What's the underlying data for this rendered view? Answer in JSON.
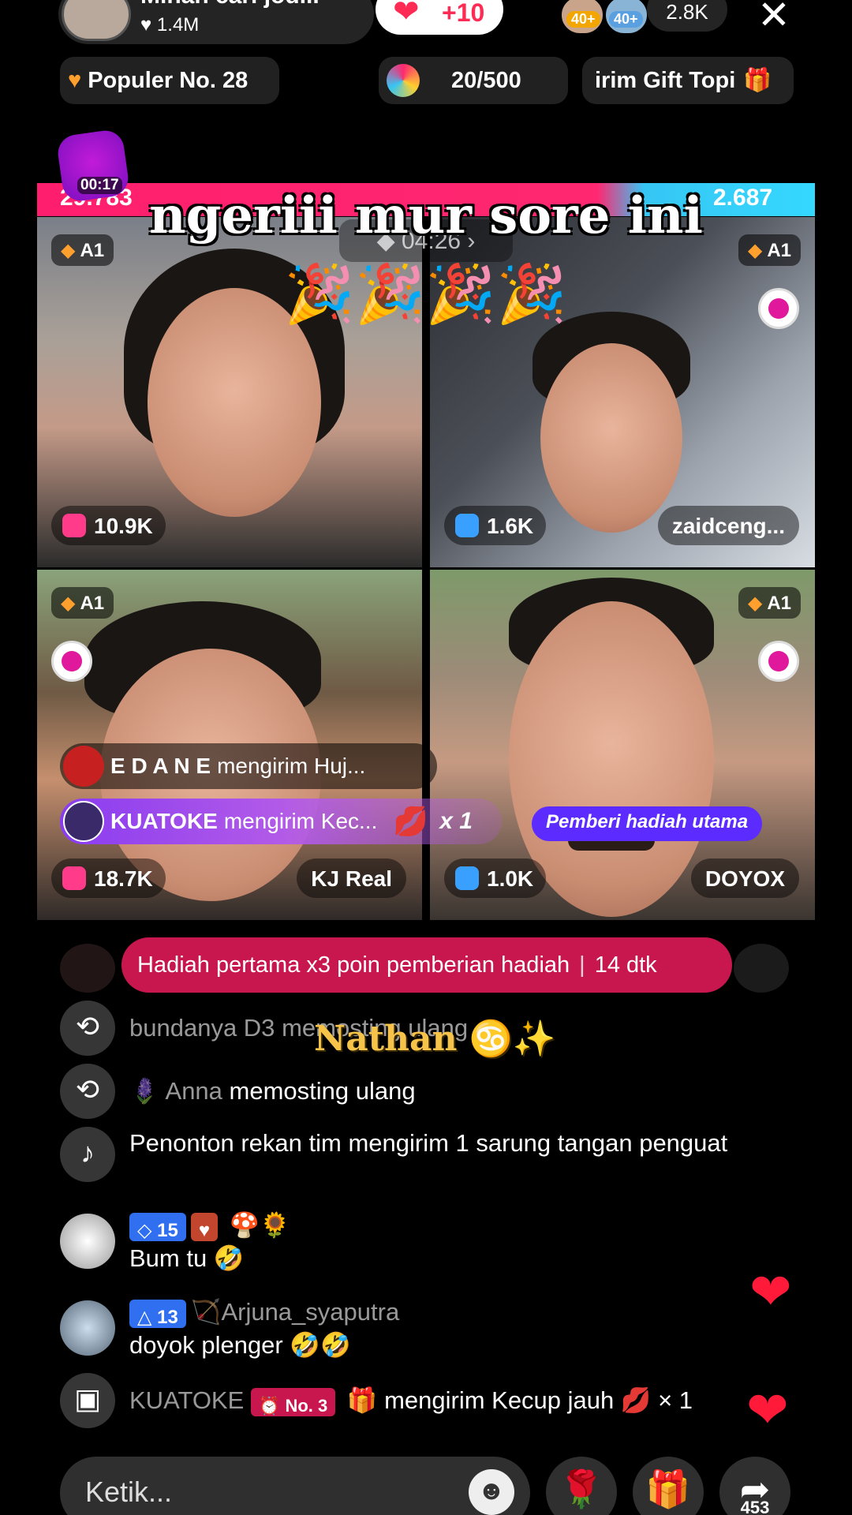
{
  "host": {
    "name": "Mihan cari jod...",
    "likes": "1.4M"
  },
  "like_button": {
    "label": "+10"
  },
  "viewers": {
    "badge_a": "40+",
    "badge_b": "40+",
    "count": "2.8K"
  },
  "chips": {
    "popular": "Populer No. 28",
    "progress": "20/500",
    "gift": "irim Gift Topi"
  },
  "battle": {
    "score_left": "29.783",
    "score_right": "2.687",
    "timer": "00:17",
    "mid_timer": "04:26",
    "overlay_text": "ngeriii mur sore ini",
    "confetti": "🎉🎉🎉🎉"
  },
  "cells": [
    {
      "rank": "A1",
      "count": "10.9K",
      "name": ""
    },
    {
      "rank": "A1",
      "count": "1.6K",
      "name": "zaidceng..."
    },
    {
      "rank": "A1",
      "count": "18.7K",
      "name": "KJ Real"
    },
    {
      "rank": "A1",
      "count": "1.0K",
      "name": "DOYOX"
    }
  ],
  "gift_notices": [
    {
      "user": "E D A N E",
      "text": "mengirim Huj..."
    },
    {
      "user": "KUATOKE",
      "text": "mengirim Kec...",
      "multiplier": "x 1"
    }
  ],
  "top_gifter_label": "Pemberi hadiah utama",
  "promo": {
    "text": "Hadiah pertama x3 poin pemberian hadiah",
    "timer": "14 dtk"
  },
  "overlay_name": "Nathan",
  "chat": [
    {
      "user": "bundanya D3",
      "text": "memosting ulang"
    },
    {
      "user": "Anna",
      "text": "memosting ulang"
    },
    {
      "text": "Penonton rekan tim mengirim 1 sarung tangan penguat"
    },
    {
      "level": "15",
      "text": "Bum tu 🤣"
    },
    {
      "level": "13",
      "user": "Arjuna_syaputra",
      "text": "doyok plenger 🤣🤣"
    },
    {
      "user": "KUATOKE",
      "badge": "No. 3",
      "text": "mengirim Kecup jauh 💋 × 1"
    }
  ],
  "input": {
    "placeholder": "Ketik..."
  },
  "share_count": "453",
  "colors": {
    "accent": "#fe2c55",
    "blue_score": "#36c6f4",
    "promo": "#c8174e",
    "gifter": "#5b2bff"
  }
}
